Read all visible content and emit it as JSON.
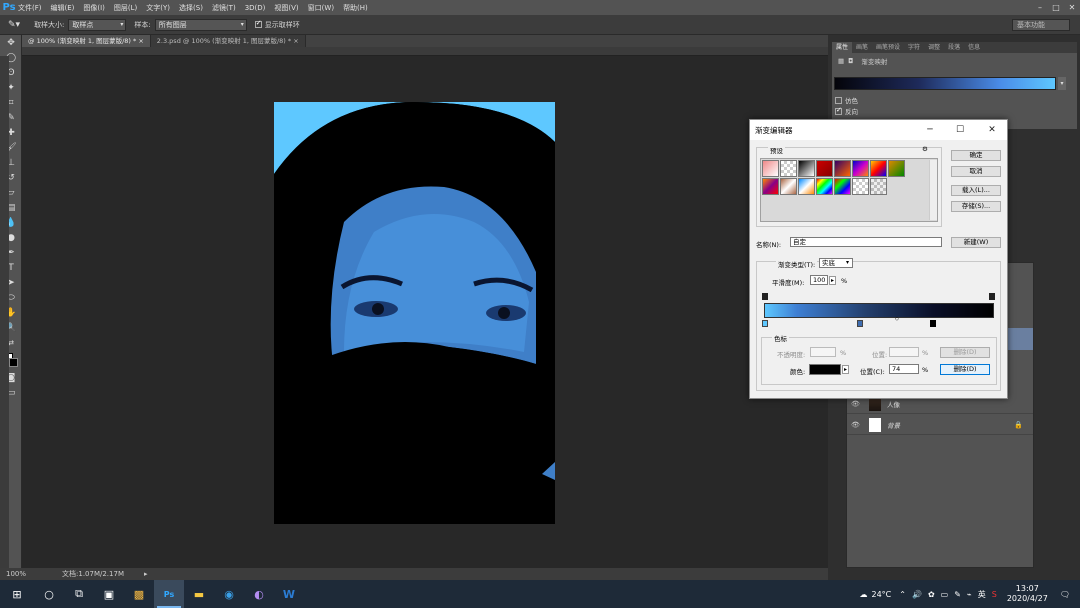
{
  "app": {
    "logo": "Ps"
  },
  "menu": [
    "文件(F)",
    "编辑(E)",
    "图像(I)",
    "图层(L)",
    "文字(Y)",
    "选择(S)",
    "滤镜(T)",
    "3D(D)",
    "视图(V)",
    "窗口(W)",
    "帮助(H)"
  ],
  "options": {
    "sample_size_label": "取样大小:",
    "sample_size_value": "取样点",
    "sample_label": "样本:",
    "sample_value": "所有图层",
    "show_ring_label": "显示取样环",
    "workspace": "基本功能"
  },
  "tabs": [
    {
      "label": "@ 100% (渐变映射 1, 图层蒙版/8) * ×"
    },
    {
      "label": "2.3.psd @ 100% (渐变映射 1, 图层蒙版/8) * ×"
    }
  ],
  "status": {
    "zoom": "100%",
    "doc": "文档:1.07M/2.17M"
  },
  "props": {
    "tabs": [
      "属性",
      "画笔",
      "画笔预设",
      "字符",
      "调整",
      "段落",
      "信息"
    ],
    "title": "渐变映射",
    "dither": "仿色",
    "reverse": "反向"
  },
  "layers": [
    {
      "name": "人像"
    },
    {
      "name": "背景"
    }
  ],
  "dialog": {
    "title": "渐变编辑器",
    "presets_label": "预设",
    "ok": "确定",
    "cancel": "取消",
    "load": "载入(L)...",
    "save": "存储(S)...",
    "name_label": "名称(N):",
    "name_value": "自定",
    "new": "新建(W)",
    "type_label": "渐变类型(T):",
    "type_value": "实底",
    "smooth_label": "平滑度(M):",
    "smooth_value": "100",
    "pct": "%",
    "stops_label": "色标",
    "opacity_label": "不透明度:",
    "loc_label": "位置:",
    "delete": "删除(D)",
    "color_label": "颜色:",
    "loc2_label": "位置(C):",
    "loc2_value": "74",
    "delete2": "删除(D)"
  },
  "taskbar": {
    "temp": "24°C",
    "ime": "英",
    "time": "13:07",
    "date": "2020/4/27"
  }
}
